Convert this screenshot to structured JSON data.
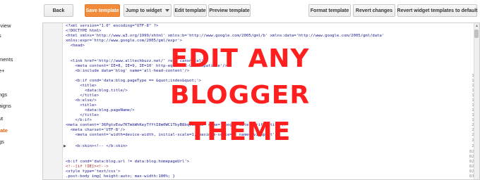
{
  "sidebar": {
    "items": [
      {
        "label": "rview",
        "active": false
      },
      {
        "label": "s",
        "active": false
      },
      {
        "label": "ments",
        "active": false
      },
      {
        "label": "e+",
        "active": false
      },
      {
        "label": "ngs",
        "active": false
      },
      {
        "label": "aigns",
        "active": false
      },
      {
        "label": "ut",
        "active": false
      },
      {
        "label": "late",
        "active": true
      },
      {
        "label": "gs",
        "active": false
      }
    ]
  },
  "toolbar": {
    "back": "Back",
    "save_template": "Save template",
    "jump_to_widget": "Jump to widget",
    "edit_template": "Edit template",
    "preview_template": "Preview template",
    "format_template": "Format template",
    "revert_changes": "Revert changes",
    "revert_widgets": "Revert widget templates to default"
  },
  "editor": {
    "lines": [
      {
        "n": "1",
        "text": "<?xml version=\"1.0\" encoding=\"UTF-8\" ?>"
      },
      {
        "n": "2",
        "text": "<!DOCTYPE html>"
      },
      {
        "n": "3",
        "text": "<html xmlns='http://www.w3.org/1999/xhtml' xmlns:b='http://www.google.com/2005/gml/b' xmlns:data='http://www.google.com/2005/gml/data'"
      },
      {
        "n": "",
        "text": "xmlns:expr='http://www.google.com/2005/gml/expr'>"
      },
      {
        "n": "4",
        "text": "  <head>"
      },
      {
        "n": "5",
        "text": ""
      },
      {
        "n": "6",
        "text": ""
      },
      {
        "n": "7",
        "text": "  <link href='http://www.alltechbuzz.net/' rel='canonical'/>"
      },
      {
        "n": "8",
        "text": "    <meta content='IE=8, IE=9, IE=10' http-equiv='X-UA-Compatible'/>"
      },
      {
        "n": "9",
        "text": "    <b:include data='blog' name='all-head-content'/>"
      },
      {
        "n": "10",
        "text": ""
      },
      {
        "n": "11",
        "text": "    <b:if cond='data:blog.pageType == &quot;index&quot;'>"
      },
      {
        "n": "12",
        "text": "      <title>"
      },
      {
        "n": "13",
        "text": "        <data:blog.title/>"
      },
      {
        "n": "14",
        "text": "      </title>"
      },
      {
        "n": "15",
        "text": "    <b:else/>"
      },
      {
        "n": "16",
        "text": "      <title>"
      },
      {
        "n": "17",
        "text": "        <data:blog.pageName/>"
      },
      {
        "n": "18",
        "text": "      </title>"
      },
      {
        "n": "19",
        "text": "    </b:if>"
      },
      {
        "n": "20",
        "text": "<meta content='36PgtvEow7KTmbWhKeyTfYtI8m0WC1TbyB8bqt0JNKo' name='google-site-verification'/>"
      },
      {
        "n": "21",
        "text": "  <meta charset='UTF-8'/>"
      },
      {
        "n": "22",
        "text": "    <meta content='width=device-width, initial-scale=1, maximum-scale=1' name='viewport'/>"
      },
      {
        "n": "23",
        "text": ""
      },
      {
        "n": "24",
        "text": "    <b:skin><!-- </b:skin>"
      },
      {
        "n": "825",
        "text": ""
      },
      {
        "n": "826",
        "text": ""
      },
      {
        "n": "827",
        "text": "<b:if cond='data:blog.url != data:blog.homepageUrl'>"
      },
      {
        "n": "828",
        "text": "<!--[if !IE]><!-->"
      },
      {
        "n": "829",
        "text": "<style type='text/css'>"
      },
      {
        "n": "830",
        "text": ".post-body img{ height:auto; max-width:100%; }"
      }
    ]
  },
  "overlay": {
    "line1": "EDIT ANY",
    "line2": "BLOGGER",
    "line3": "THEME"
  },
  "colors": {
    "accent_orange": "#f28c3b",
    "overlay_red": "#ff1f1f",
    "code_blue": "#1a1a8c"
  }
}
